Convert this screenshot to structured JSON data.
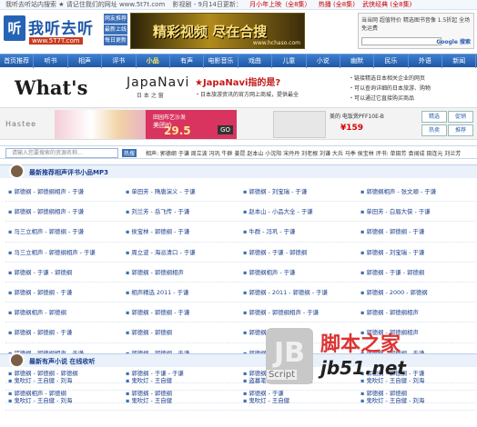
{
  "topline": {
    "left": "我听去听站内搜索   ★ 请记住我们的网址 www.5t7t.com",
    "mid": "影视剧 - 9月14日更新：",
    "hot1": "月小年上映（全8集）",
    "hot2": "热播 (全8集)",
    "hot3": "武侠经典 (全8集)"
  },
  "logo": {
    "mark": "听",
    "name": "我听去听",
    "url": "www.5T7T.com",
    "tags": [
      "网友推荐",
      "最新上线",
      "每日更新"
    ]
  },
  "banner": {
    "title": "精彩视频 尽在合搜",
    "url": "www.hchaso.com"
  },
  "rbox": {
    "ad": "当当网 超值特价 精选图书音像 1.5折起 全场免运费",
    "google": "Google 搜索"
  },
  "nav": [
    "首页推荐",
    "听书",
    "相声",
    "评书",
    "小品",
    "有声",
    "电影音乐",
    "戏曲",
    "儿童",
    "小说",
    "幽默",
    "民乐",
    "外语",
    "新闻"
  ],
  "nav_active": 4,
  "japa": {
    "whats": "What's",
    "brand": "JapaNavi",
    "brand_sub": "日 本 之 窗",
    "q": "★JapaNavi指的是?",
    "desc": "・日本旅游资讯的官方网上商城，提供最全",
    "points": [
      "・链接精选日本相关企业的网页",
      "・可以查询详细的日本旅游、购物",
      "・可以通过它直接购买商品"
    ]
  },
  "product": {
    "hastee": "Hastee",
    "sale_a": "田园布艺沙发",
    "sale_b": "美团价",
    "sale_c": "29.5",
    "sale_go": "GO",
    "machine": "美的 电饭煲PFF10E-B",
    "price": "¥159",
    "btns": [
      "精选",
      "促销",
      "热卖",
      "推荐",
      "大促",
      "优惠"
    ]
  },
  "ticker": {
    "search": "请输入您要搜索的资源名称...",
    "label": "热搜",
    "text": "相声: 郭德纲 于谦 周立波 冯巩 牛群 姜昆 赵本山 小沈阳 宋丹丹 刘老根 刘谦 大兵 马季 侯宝林 评书: 单田芳 袁阔成 田连元 刘兰芳"
  },
  "sections": [
    {
      "title": "最新推荐相声评书小品MP3",
      "cells": [
        "郭德纲 - 郭德纲相声 - 于谦",
        "单田芳 - 隋唐演义 - 于谦",
        "郭德纲 - 刘宝瑞 - 于谦",
        "郭德纲相声 - 张文顺 - 于谦",
        "郭德纲 - 郭德纲相声 - 于谦",
        "刘兰芳 - 岳飞传 - 于谦",
        "赵本山 - 小品大全 - 于谦",
        "单田芳 - 白眉大侠 - 于谦",
        "马三立相声 - 郭德纲 - 于谦",
        "侯宝林 - 郭德纲 - 于谦",
        "牛群 - 冯巩 - 于谦",
        "郭德纲 - 郭德纲 - 于谦",
        "马三立相声 - 郭德纲相声 - 于谦",
        "周立波 - 海派清口 - 于谦",
        "郭德纲 - 于谦 - 郭德纲",
        "郭德纲 - 刘宝瑞 - 于谦",
        "郭德纲 - 于谦 - 郭德纲",
        "郭德纲 - 郭德纲相声",
        "郭德纲相声 - 于谦",
        "郭德纲 - 于谦 - 郭德纲",
        "郭德纲 - 郭德纲 - 于谦",
        "相声精选 2011 - 于谦",
        "郭德纲 - 2011 - 郭德纲 - 于谦",
        "郭德纲 - 2000 - 郭德纲",
        "郭德纲相声 - 郭德纲",
        "郭德纲 - 郭德纲 - 于谦",
        "郭德纲 - 郭德纲相声 - 于谦",
        "郭德纲 - 郭德纲相声",
        "郭德纲 - 郭德纲 - 于谦",
        "郭德纲 - 郭德纲",
        "郭德纲相声 - 于谦",
        "郭德纲 - 郭德纲相声",
        "郭德纲 - 郭德纲相声 - 于谦",
        "郭德纲 - 郭德纲 - 于谦",
        "郭德纲 - 于谦",
        "郭德纲 - 郭德纲 - 于谦",
        "郭德纲 - 郭德纲 - 郭德纲",
        "郭德纲 - 于谦 - 于谦",
        "郭德纲 - 于谦 - 于谦",
        "郭德纲 - 郭德纲 - 于谦",
        "郭德纲相声 - 郭德纲",
        "郭德纲 - 郭德纲",
        "郭德纲 - 于谦",
        "郭德纲 - 郭德纲"
      ]
    },
    {
      "title": "最新有声小说 在线收听",
      "cells": [
        "鬼吹灯 - 王自健 - 刘海",
        "鬼吹灯 - 王自健",
        "盗墓笔记 - 王自健 - 刘海",
        "鬼吹灯 - 王自健 - 刘海",
        "鬼吹灯 - 王自健 - 刘海",
        "鬼吹灯 - 王自健",
        "鬼吹灯 - 王自健",
        "鬼吹灯 - 王自健 - 刘海"
      ]
    }
  ],
  "watermark": {
    "jb": "JB",
    "script": "Script",
    "cn": "脚本之家",
    "net": "jb51.net"
  }
}
